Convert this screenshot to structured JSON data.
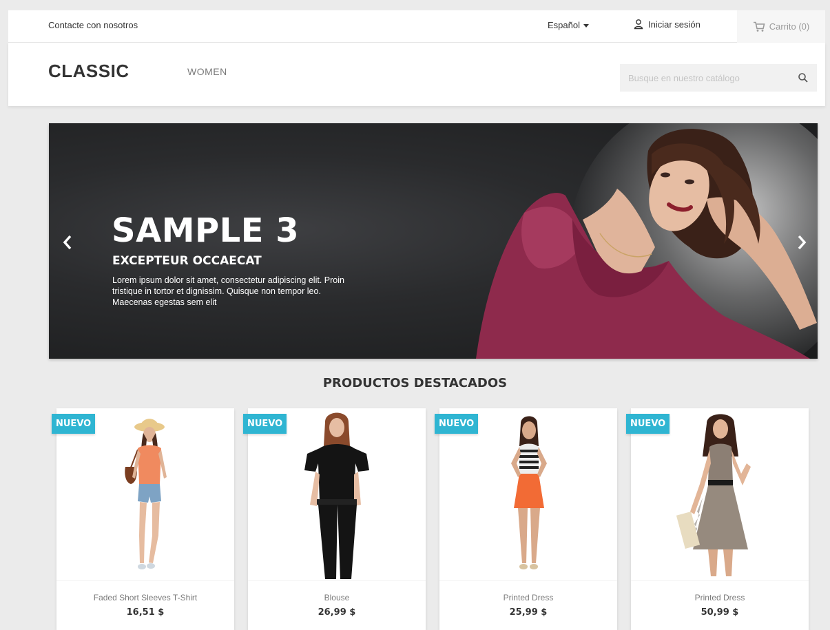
{
  "topbar": {
    "contact_label": "Contacte con nosotros",
    "language_label": "Español",
    "login_label": "Iniciar sesión",
    "cart_label": "Carrito (0)"
  },
  "header": {
    "logo": "CLASSIC",
    "nav": [
      {
        "label": "WOMEN"
      }
    ],
    "search_placeholder": "Busque en nuestro catálogo"
  },
  "slider": {
    "title": "SAMPLE 3",
    "subtitle": "EXCEPTEUR OCCAECAT",
    "text": "Lorem ipsum dolor sit amet, consectetur adipiscing elit. Proin tristique in tortor et dignissim. Quisque non tempor leo. Maecenas egestas sem elit"
  },
  "section": {
    "title": "PRODUCTOS DESTACADOS"
  },
  "products": [
    {
      "badge": "NUEVO",
      "name": "Faded Short Sleeves T-Shirt",
      "price": "16,51 $"
    },
    {
      "badge": "NUEVO",
      "name": "Blouse",
      "price": "26,99 $"
    },
    {
      "badge": "NUEVO",
      "name": "Printed Dress",
      "price": "25,99 $"
    },
    {
      "badge": "NUEVO",
      "name": "Printed Dress",
      "price": "50,99 $"
    }
  ],
  "colors": {
    "accent": "#2fb5d2",
    "background": "#ebebeb",
    "text": "#333333",
    "muted": "#7a7a7a"
  }
}
